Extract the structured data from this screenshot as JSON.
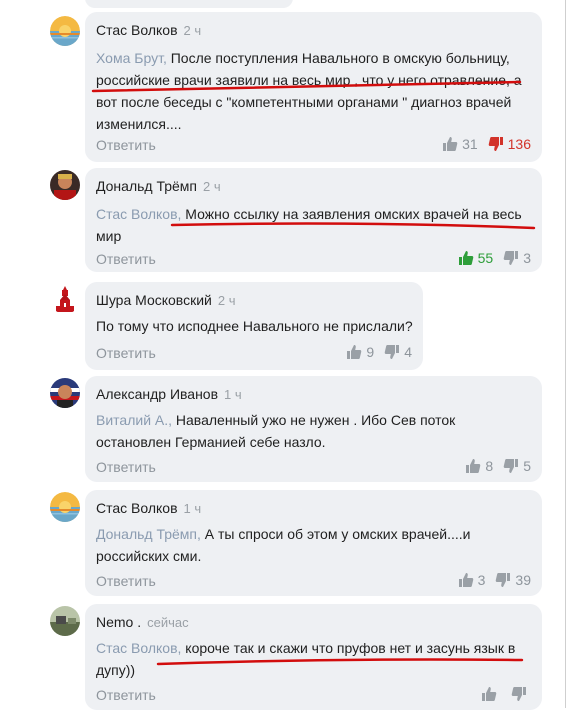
{
  "colors": {
    "bubble_bg": "#eef0f3",
    "reply_to": "#8a9bb0",
    "muted": "#8e959c",
    "like_green": "#2e9e3a",
    "dislike_red": "#d2332a",
    "underline_red": "#d20d0d"
  },
  "comments": [
    {
      "author": "Стас Волков",
      "time": "2 ч",
      "reply_to": "Хома Брут,",
      "lines": [
        " После поступления  Навального в омскую больницу,",
        "российские врачи заявили на весь мир , что у него отравление, а",
        "вот после беседы с \"компетентными органами \" диагноз врачей",
        "изменился...."
      ],
      "reply_label": "Ответить",
      "likes": "31",
      "dislikes": "136",
      "avatar_icon": "sunset-avatar-icon"
    },
    {
      "author": "Дональд Трёмп",
      "time": "2 ч",
      "reply_to": "Стас Волков,",
      "lines": [
        " Можно ссылку на заявления омских врачей на весь",
        "мир"
      ],
      "reply_label": "Ответить",
      "likes": "55",
      "dislikes": "3",
      "avatar_icon": "person-photo-avatar-icon"
    },
    {
      "author": "Шура Московский",
      "time": "2 ч",
      "reply_to": "",
      "lines": [
        "По тому что исподнее Навального не прислали?"
      ],
      "reply_label": "Ответить",
      "likes": "9",
      "dislikes": "4",
      "avatar_icon": "kremlin-tower-avatar-icon"
    },
    {
      "author": "Александр Иванов",
      "time": "1 ч",
      "reply_to": "Виталий А.,",
      "lines": [
        " Наваленный ужо не нужен . Ибо Сев  поток",
        "остановлен Германией себе назло."
      ],
      "reply_label": "Ответить",
      "likes": "8",
      "dislikes": "5",
      "avatar_icon": "flag-portrait-avatar-icon"
    },
    {
      "author": "Стас Волков",
      "time": "1 ч",
      "reply_to": "Дональд Трёмп,",
      "lines": [
        " А ты спроси об этом у омских врачей....и",
        "российских сми."
      ],
      "reply_label": "Ответить",
      "likes": "3",
      "dislikes": "39",
      "avatar_icon": "sunset-avatar-icon"
    },
    {
      "author": "Nemo .",
      "time": "сейчас",
      "reply_to": "Стас Волков,",
      "lines": [
        " короче так и скажи что пруфов нет и засунь язык в",
        "дупу))"
      ],
      "reply_label": "Ответить",
      "likes": "",
      "dislikes": "",
      "avatar_icon": "landscape-avatar-icon"
    }
  ]
}
